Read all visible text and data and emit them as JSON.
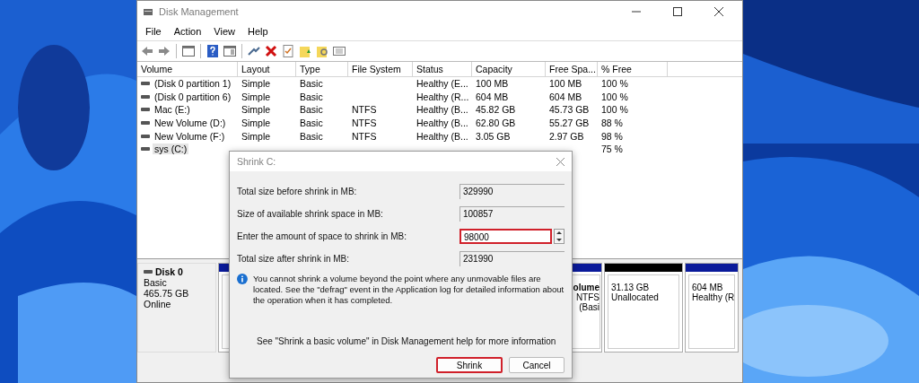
{
  "window": {
    "title": "Disk Management"
  },
  "menu": [
    "File",
    "Action",
    "View",
    "Help"
  ],
  "volumes": {
    "columns": [
      "Volume",
      "Layout",
      "Type",
      "File System",
      "Status",
      "Capacity",
      "Free Spa...",
      "% Free"
    ],
    "rows": [
      {
        "selected": false,
        "volume": "(Disk 0 partition 1)",
        "layout": "Simple",
        "type": "Basic",
        "status": "Healthy (E...",
        "capacity": "100 MB",
        "free_space": "100 MB",
        "percent_free": "100 %"
      },
      {
        "selected": false,
        "volume": "(Disk 0 partition 6)",
        "layout": "Simple",
        "type": "Basic",
        "status": "Healthy (R...",
        "capacity": "604 MB",
        "free_space": "604 MB",
        "percent_free": "100 %"
      },
      {
        "selected": false,
        "volume": "Mac (E:)",
        "layout": "Simple",
        "type": "Basic",
        "file_system": "NTFS",
        "status": "Healthy (B...",
        "capacity": "45.82 GB",
        "free_space": "45.73 GB",
        "percent_free": "100 %"
      },
      {
        "selected": false,
        "volume": "New Volume (D:)",
        "layout": "Simple",
        "type": "Basic",
        "file_system": "NTFS",
        "status": "Healthy (B...",
        "capacity": "62.80 GB",
        "free_space": "55.27 GB",
        "percent_free": "88 %"
      },
      {
        "selected": false,
        "volume": "New Volume (F:)",
        "layout": "Simple",
        "type": "Basic",
        "file_system": "NTFS",
        "status": "Healthy (B...",
        "capacity": "3.05 GB",
        "free_space": "2.97 GB",
        "percent_free": "98 %"
      },
      {
        "selected": true,
        "volume": "sys (C:)",
        "percent_free": "75 %"
      }
    ]
  },
  "disk": {
    "name": "Disk 0",
    "type": "Basic",
    "size": "465.75 GB",
    "status": "Online",
    "partitions": [
      {
        "kind": "primary"
      },
      {
        "kind": "primary",
        "lines": [
          "olume",
          "NTFS",
          "(Basi"
        ]
      },
      {
        "kind": "unallocated",
        "lines": [
          "31.13 GB",
          "Unallocated"
        ]
      },
      {
        "kind": "primary",
        "lines": [
          "604 MB",
          "Healthy (R"
        ]
      }
    ]
  },
  "dialog": {
    "title": "Shrink C:",
    "fields": [
      {
        "kind": "readonly",
        "label": "Total size before shrink in MB:",
        "value": "329990",
        "highlighted": false
      },
      {
        "kind": "readonly",
        "label": "Size of available shrink space in MB:",
        "value": "100857",
        "highlighted": false
      },
      {
        "kind": "spin",
        "label": "Enter the amount of space to shrink in MB:",
        "value": "98000",
        "highlighted": true
      },
      {
        "kind": "readonly",
        "label": "Total size after shrink in MB:",
        "value": "231990",
        "highlighted": false
      }
    ],
    "info": "You cannot shrink a volume beyond the point where any unmovable files are located. See the \"defrag\" event in the Application log for detailed information about the operation when it has completed.",
    "help": "See \"Shrink a basic volume\" in Disk Management help for more information",
    "buttons": [
      {
        "label": "Shrink",
        "highlighted": true
      },
      {
        "label": "Cancel",
        "highlighted": false
      }
    ]
  }
}
